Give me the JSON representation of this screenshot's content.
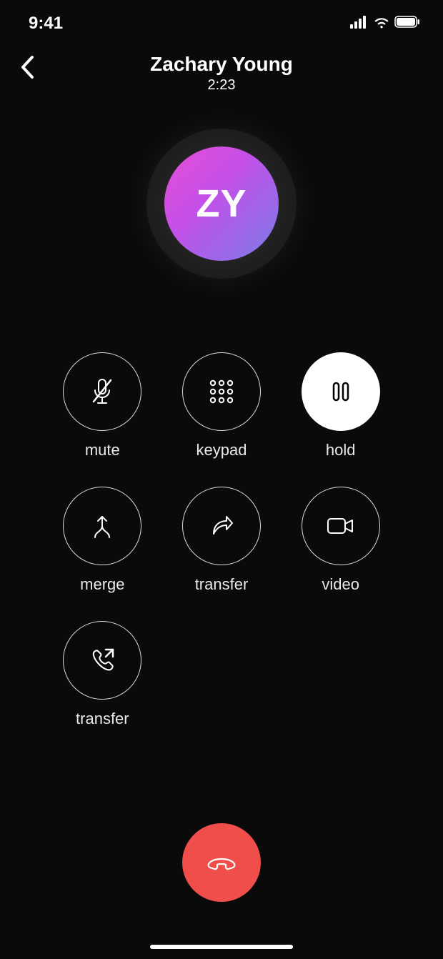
{
  "status": {
    "time": "9:41"
  },
  "call": {
    "name": "Zachary Young",
    "duration": "2:23",
    "initials": "ZY"
  },
  "controls": {
    "mute": "mute",
    "keypad": "keypad",
    "hold": "hold",
    "merge": "merge",
    "transfer": "transfer",
    "video": "video",
    "call_transfer": "transfer"
  },
  "colors": {
    "end_call": "#ef4e4a",
    "avatar_gradient_start": "#e84fd3",
    "avatar_gradient_end": "#7a7ce8"
  }
}
